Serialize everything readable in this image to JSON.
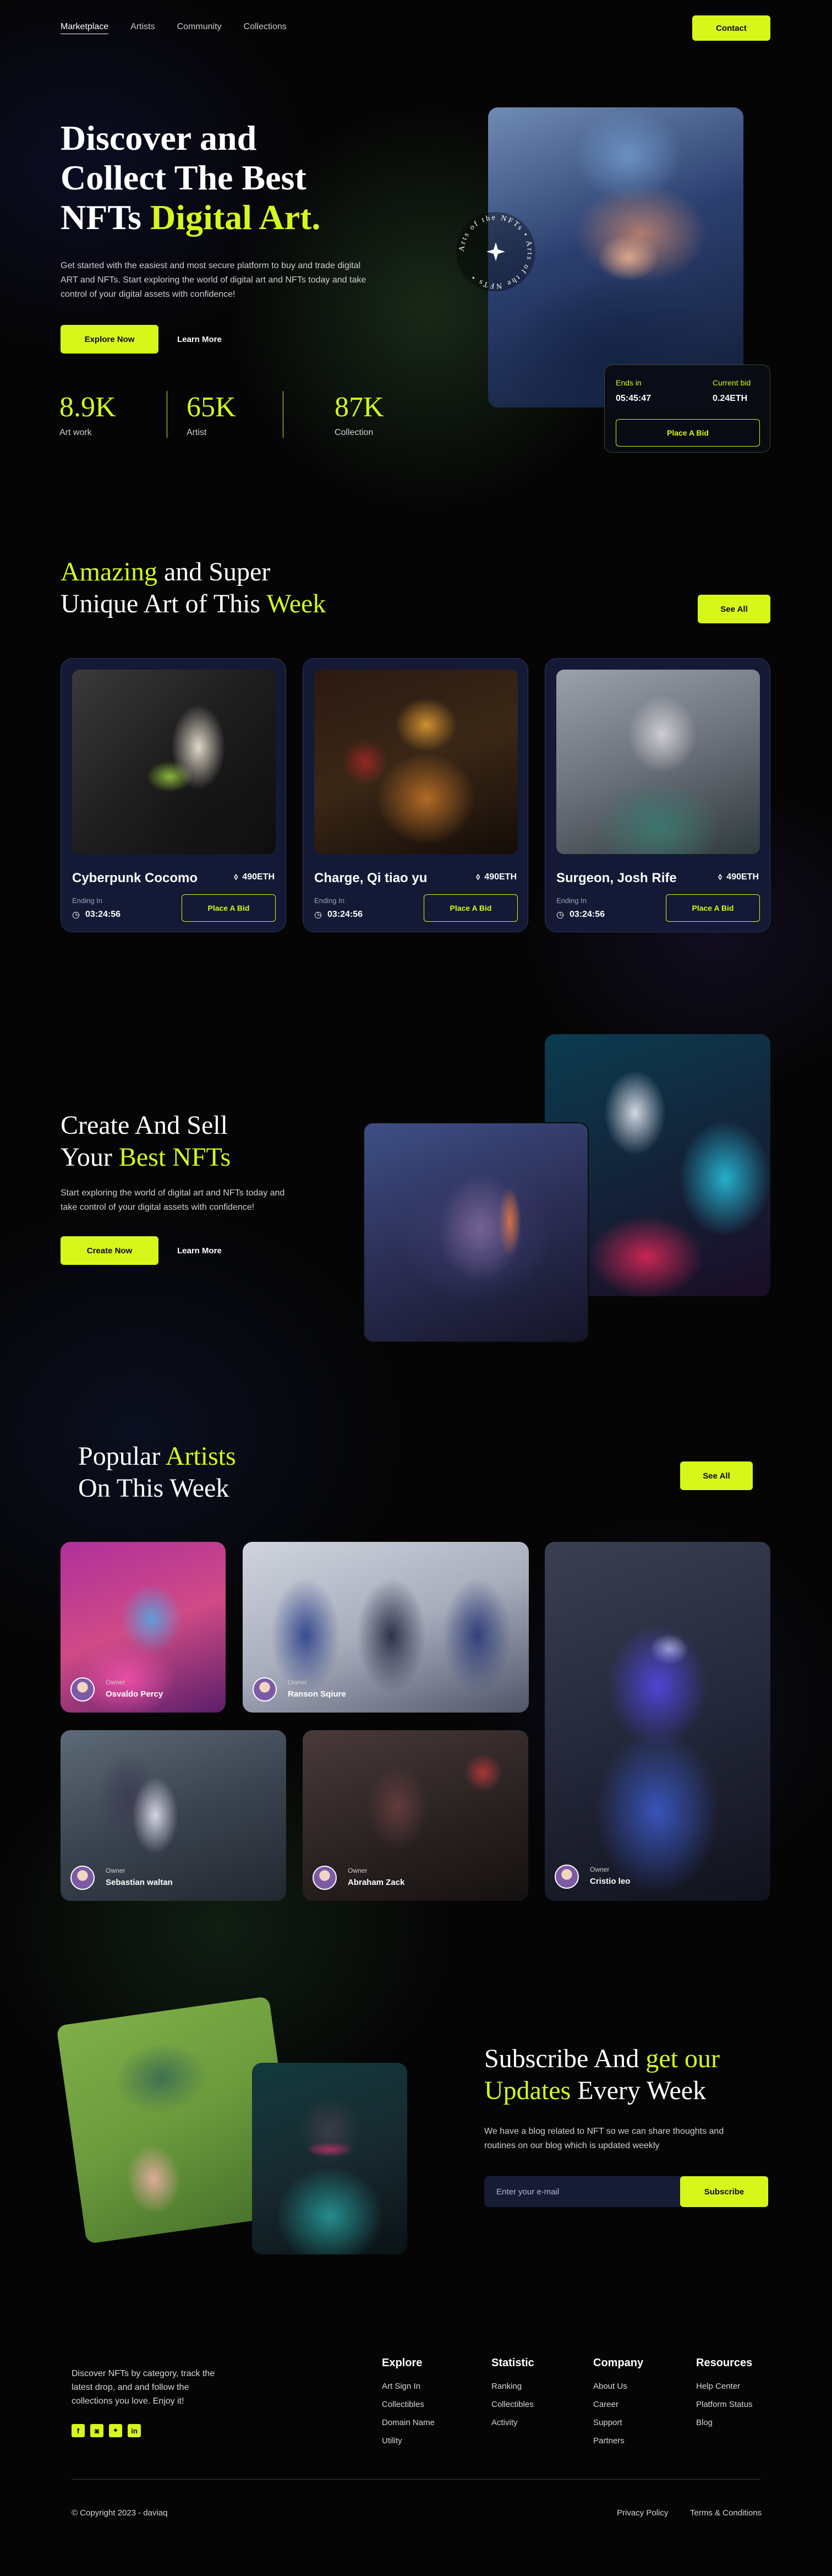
{
  "nav": {
    "links": [
      "Marketplace",
      "Artists",
      "Community",
      "Collections"
    ],
    "contact_label": "Contact"
  },
  "hero": {
    "title_line1": "Discover and",
    "title_line2": "Collect The Best",
    "title_line3_plain": "NFTs ",
    "title_line3_accent": "Digital Art.",
    "subtitle": "Get started with the easiest and most secure platform to buy and trade digital ART and NFTs. Start exploring the world of digital art and NFTs today and take control of your digital assets with confidence!",
    "explore_label": "Explore Now",
    "learn_label": "Learn More",
    "stats": [
      {
        "value": "8.9K",
        "label": "Art work"
      },
      {
        "value": "65K",
        "label": "Artist"
      },
      {
        "value": "87K",
        "label": "Collection"
      }
    ],
    "circle_text": "Arts of the NFTs • Arts of the NFTs •",
    "bid": {
      "ends_label": "Ends in",
      "ends_value": "05:45:47",
      "current_label": "Current bid",
      "current_value": "0.24ETH",
      "button_label": "Place A Bid"
    }
  },
  "weekly": {
    "title_accent1": "Amazing",
    "title_plain1": " and Super",
    "title_plain2": "Unique Art of This ",
    "title_accent2": "Week",
    "see_all_label": "See All",
    "cards": [
      {
        "name": "Cyberpunk Cocomo",
        "price": "490ETH",
        "ending_label": "Ending In",
        "time": "03:24:56",
        "button": "Place A Bid"
      },
      {
        "name": "Charge, Qi tiao yu",
        "price": "490ETH",
        "ending_label": "Ending In",
        "time": "03:24:56",
        "button": "Place A Bid"
      },
      {
        "name": "Surgeon, Josh Rife",
        "price": "490ETH",
        "ending_label": "Ending In",
        "time": "03:24:56",
        "button": "Place A Bid"
      }
    ]
  },
  "create": {
    "title_line1": "Create And Sell",
    "title_plain2": "Your ",
    "title_accent2": "Best NFTs",
    "subtitle": "Start exploring the world of digital art and NFTs today and take control of your digital assets with confidence!",
    "create_label": "Create Now",
    "learn_label": "Learn More"
  },
  "artists": {
    "title_plain1": "Popular ",
    "title_accent1": "Artists",
    "title_line2": "On This Week",
    "see_all_label": "See All",
    "owner_label": "Owner",
    "items": [
      {
        "owner": "Osvaldo Percy"
      },
      {
        "owner": "Ranson Sqiure"
      },
      {
        "owner": "Cristio leo"
      },
      {
        "owner": "Sebastian waltan"
      },
      {
        "owner": "Abraham Zack"
      }
    ]
  },
  "subscribe": {
    "title_plain1": "Subscribe And ",
    "title_accent1": "get our",
    "title_accent2": "Updates",
    "title_plain2": " Every Week",
    "subtitle": "We have a blog related to NFT so we can share thoughts and routines on our blog which is updated weekly",
    "placeholder": "Enter your e-mail",
    "button_label": "Subscribe"
  },
  "footer": {
    "description": "Discover NFTs by category, track the latest drop, and and follow the collections you love. Enjoy it!",
    "social": [
      "f",
      "ig",
      "tw",
      "in"
    ],
    "columns": [
      {
        "title": "Explore",
        "links": [
          "Art Sign In",
          "Collectibles",
          "Domain Name",
          "Utility"
        ]
      },
      {
        "title": "Statistic",
        "links": [
          "Ranking",
          "Collectibles",
          "Activity"
        ]
      },
      {
        "title": "Company",
        "links": [
          "About Us",
          "Career",
          "Support",
          "Partners"
        ]
      },
      {
        "title": "Resources",
        "links": [
          "Help Center",
          "Platform Status",
          "Blog"
        ]
      }
    ],
    "copyright": "© Copyright 2023 - daviaq",
    "privacy": "Privacy Policy",
    "terms": "Terms & Conditions"
  },
  "colors": {
    "accent": "#d7f71b",
    "background": "#050505",
    "card": "#141a35"
  }
}
